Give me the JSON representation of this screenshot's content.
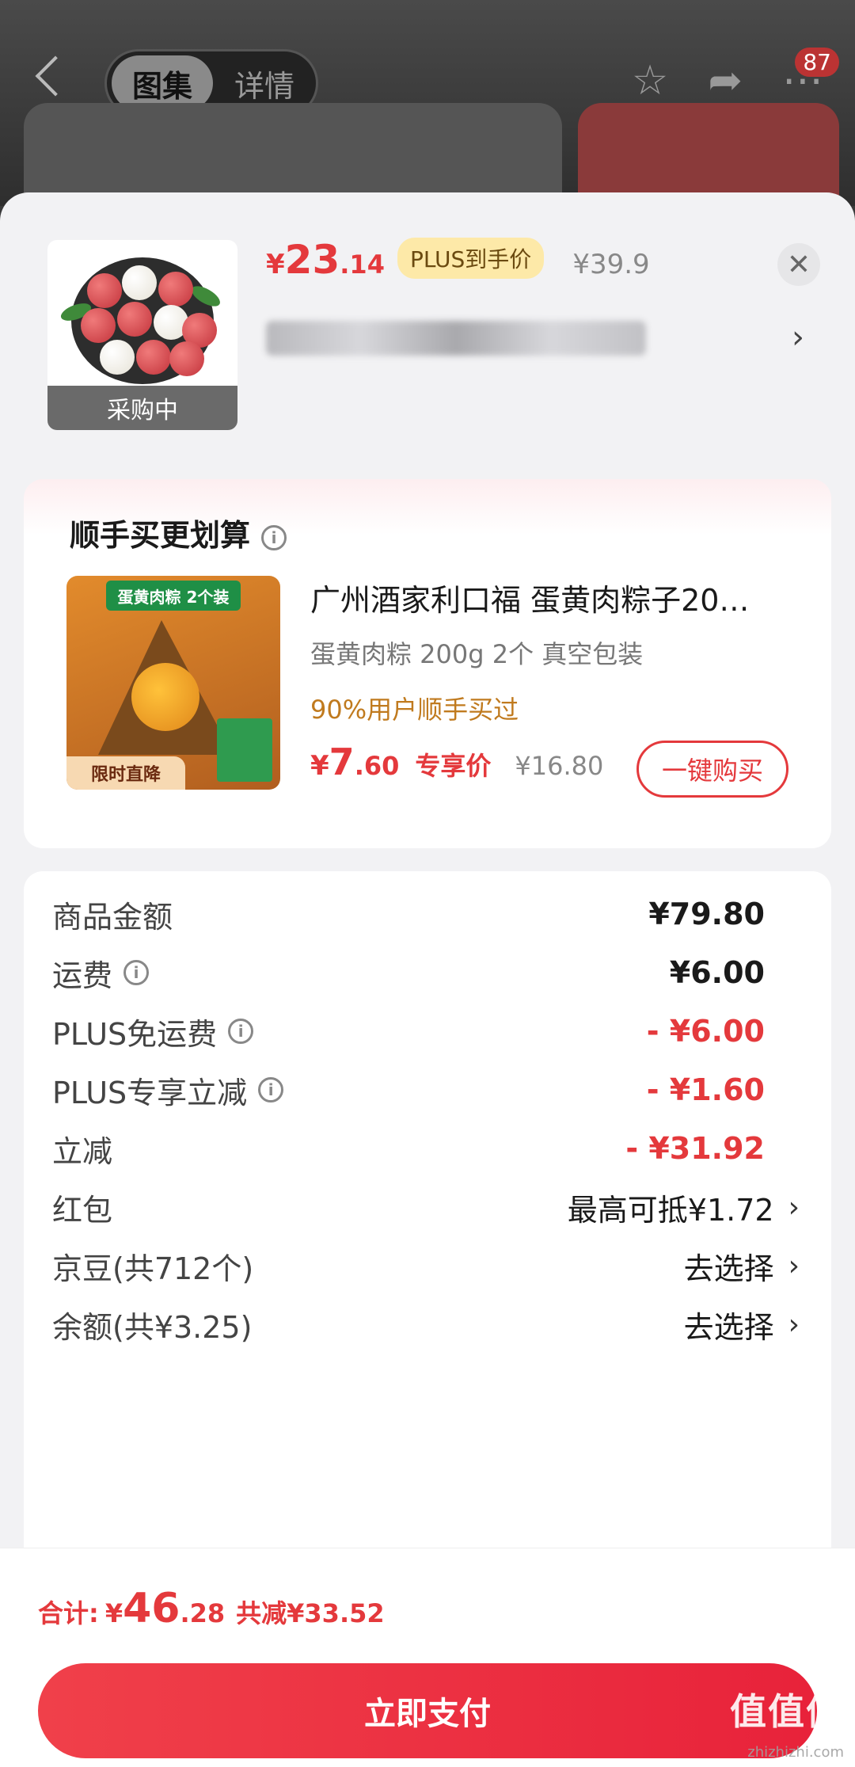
{
  "background": {
    "tabs": [
      {
        "label": "图集",
        "active": true
      },
      {
        "label": "详情",
        "active": false
      }
    ],
    "badge_count": "87",
    "icons": [
      "chevron-left-icon",
      "star-icon",
      "share-icon",
      "more-icon"
    ]
  },
  "product": {
    "currency": "¥",
    "price_int": "23",
    "price_dec": ".14",
    "plus_tag": "PLUS到手价",
    "original_price": "¥39.9",
    "status_label": "采购中",
    "title_blurred": true
  },
  "bundle": {
    "header": "顺手买更划算",
    "item": {
      "name": "广州酒家利口福 蛋黄肉粽子20…",
      "spec": "蛋黄肉粽 200g 2个 真空包装",
      "social_proof": "90%用户顺手买过",
      "currency": "¥",
      "price_int": "7",
      "price_dec": ".60",
      "price_label": "专享价",
      "original_price": "¥16.80",
      "buy_button": "一键购买",
      "image_banner": "蛋黄肉粽 2个装",
      "image_tag": "限时直降"
    }
  },
  "fees": [
    {
      "label": "商品金额",
      "value": "¥79.80",
      "info": false,
      "type": "normal"
    },
    {
      "label": "运费",
      "value": "¥6.00",
      "info": true,
      "type": "normal"
    },
    {
      "label": "PLUS免运费",
      "value": "- ¥6.00",
      "info": true,
      "type": "neg"
    },
    {
      "label": "PLUS专享立减",
      "value": "- ¥1.60",
      "info": true,
      "type": "neg"
    },
    {
      "label": "立减",
      "value": "- ¥31.92",
      "info": false,
      "type": "neg"
    },
    {
      "label": "红包",
      "value": "最高可抵¥1.72",
      "info": false,
      "type": "link"
    },
    {
      "label": "京豆(共712个)",
      "value": "去选择",
      "info": false,
      "type": "link"
    },
    {
      "label": "余额(共¥3.25)",
      "value": "去选择",
      "info": false,
      "type": "link"
    }
  ],
  "summary": {
    "label": "合计:",
    "currency": "¥",
    "total_int": "46",
    "total_dec": ".28",
    "saved": "共减¥33.52"
  },
  "pay_button": "立即支付",
  "watermark": {
    "brand": "值值值",
    "site": "zhizhizhi.com"
  },
  "colors": {
    "accent": "#e4393c",
    "plus_tag_bg": "#fde9a8",
    "sheet_bg": "#f2f2f4"
  }
}
